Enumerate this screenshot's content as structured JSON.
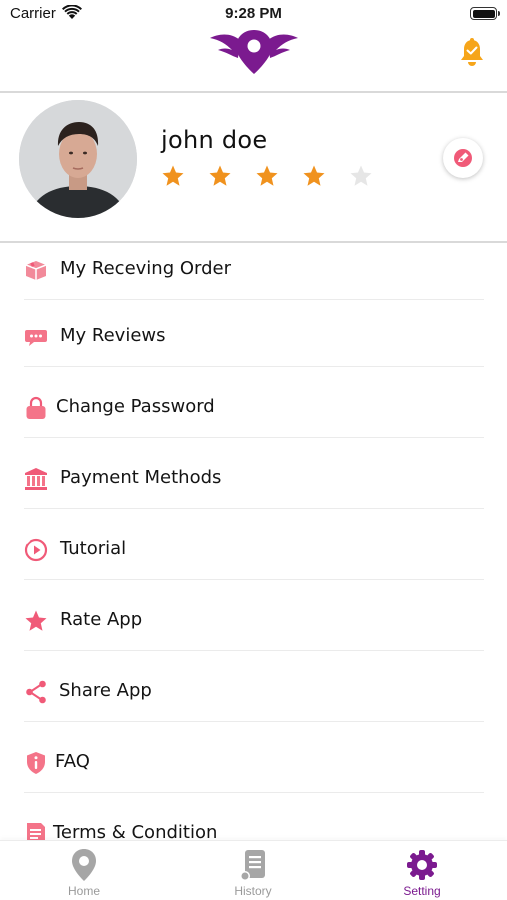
{
  "status_bar": {
    "carrier": "Carrier",
    "time": "9:28 PM"
  },
  "header": {
    "logo": "winged-pin-logo",
    "notification_icon": "bell-icon"
  },
  "profile": {
    "name": "john doe",
    "rating": 4,
    "rating_max": 5,
    "edit_icon": "edit-pencil-icon"
  },
  "menu": {
    "items": [
      {
        "label": "My Receving Order",
        "icon": "box-icon"
      },
      {
        "label": "My Reviews",
        "icon": "chat-bubble-icon"
      },
      {
        "label": "Change Password",
        "icon": "lock-icon"
      },
      {
        "label": "Payment Methods",
        "icon": "bank-icon"
      },
      {
        "label": "Tutorial",
        "icon": "play-circle-icon"
      },
      {
        "label": "Rate App",
        "icon": "star-icon"
      },
      {
        "label": "Share App",
        "icon": "share-icon"
      },
      {
        "label": "FAQ",
        "icon": "info-shield-icon"
      },
      {
        "label": "Terms & Condition",
        "icon": "document-icon"
      }
    ]
  },
  "tabbar": {
    "tabs": [
      {
        "label": "Home",
        "icon": "location-pin-icon",
        "active": false
      },
      {
        "label": "History",
        "icon": "receipt-icon",
        "active": false
      },
      {
        "label": "Setting",
        "icon": "gear-icon",
        "active": true
      }
    ]
  },
  "colors": {
    "brand_purple": "#7b1a8f",
    "star_filled": "#f0921e",
    "star_empty": "#e6e6e6",
    "icon_pink": "#f05a78",
    "bell_orange": "#f6a51a",
    "tab_inactive": "#9a9a9a"
  }
}
